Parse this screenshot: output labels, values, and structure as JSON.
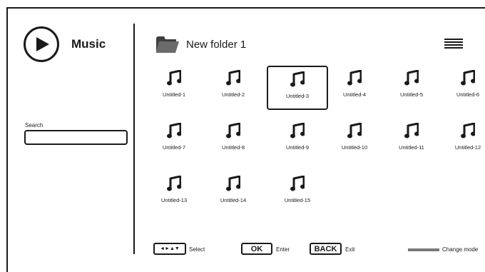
{
  "sidebar": {
    "title": "Music",
    "search_label": "Search",
    "search_value": ""
  },
  "folder": {
    "title": "New folder 1"
  },
  "items": [
    {
      "label": "Untitled-1",
      "selected": false
    },
    {
      "label": "Untitled-2",
      "selected": false
    },
    {
      "label": "Untitled-3",
      "selected": true
    },
    {
      "label": "Untitled-4",
      "selected": false
    },
    {
      "label": "Untitled-5",
      "selected": false
    },
    {
      "label": "Untitled-6",
      "selected": false
    },
    {
      "label": "Untitled-7",
      "selected": false
    },
    {
      "label": "Untitled-8",
      "selected": false
    },
    {
      "label": "Untitled-9",
      "selected": false
    },
    {
      "label": "Untitled-10",
      "selected": false
    },
    {
      "label": "Untitled-11",
      "selected": false
    },
    {
      "label": "Untitled-12",
      "selected": false
    },
    {
      "label": "Untitled-13",
      "selected": false
    },
    {
      "label": "Untitled-14",
      "selected": false
    },
    {
      "label": "Untitled-15",
      "selected": false
    }
  ],
  "footer": {
    "arrows_key": "◄►▲▼",
    "select_label": "Select",
    "ok_key": "OK",
    "enter_label": "Enter",
    "back_key": "BACK",
    "exit_label": "Exit",
    "change_mode_label": "Change mode"
  },
  "icons": {
    "play": "play-icon",
    "folder": "folder-icon",
    "menu": "list-view-icon",
    "item": "music-note-icon"
  },
  "colors": {
    "foreground": "#1a1a1a",
    "folder_fill": "#6b6b6b",
    "mode_indicator": "#7a7a7a"
  }
}
